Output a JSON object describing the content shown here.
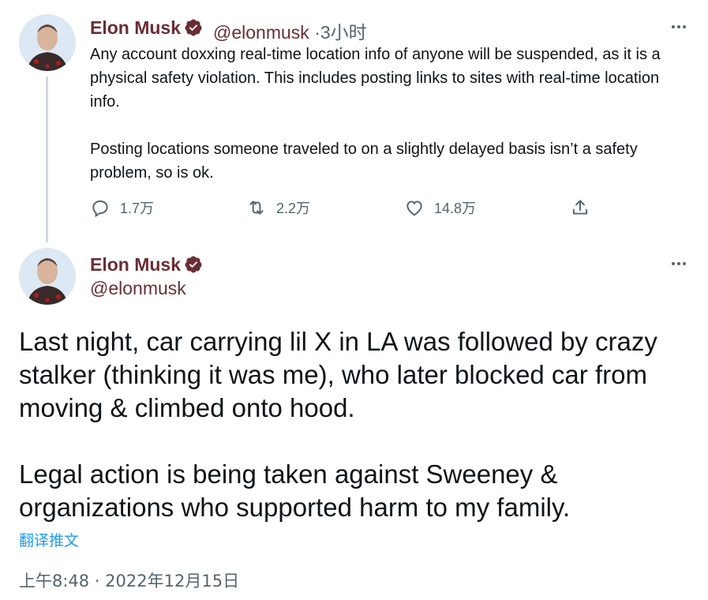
{
  "tweet1": {
    "name": "Elon Musk",
    "handle": "@elonmusk",
    "separator": "·",
    "time": "3小时",
    "paragraphs": [
      "Any account doxxing real-time location info of anyone will be suspended, as it is a physical safety violation. This includes posting links to sites with real-time location info.",
      "Posting locations someone traveled to on a slightly delayed basis isn’t a safety problem, so is ok."
    ],
    "actions": {
      "replies": "1.7万",
      "retweets": "2.2万",
      "likes": "14.8万"
    }
  },
  "tweet2": {
    "name": "Elon Musk",
    "handle": "@elonmusk",
    "paragraphs": [
      "Last night, car carrying lil X in LA was followed by crazy stalker (thinking it was me), who later blocked car from moving & climbed onto hood.",
      "Legal action is being taken against Sweeney & organizations who supported harm to my family."
    ],
    "translate_label": "翻译推文",
    "timestamp": "上午8:48 · 2022年12月15日"
  },
  "colors": {
    "name": "#6b2d34",
    "secondary": "#536471",
    "link": "#1d9bf0",
    "verified": "#6b2d34",
    "thread_line": "#cfd9de"
  },
  "icons": [
    "more-icon",
    "reply-icon",
    "retweet-icon",
    "like-icon",
    "share-icon",
    "verified-badge-icon"
  ]
}
